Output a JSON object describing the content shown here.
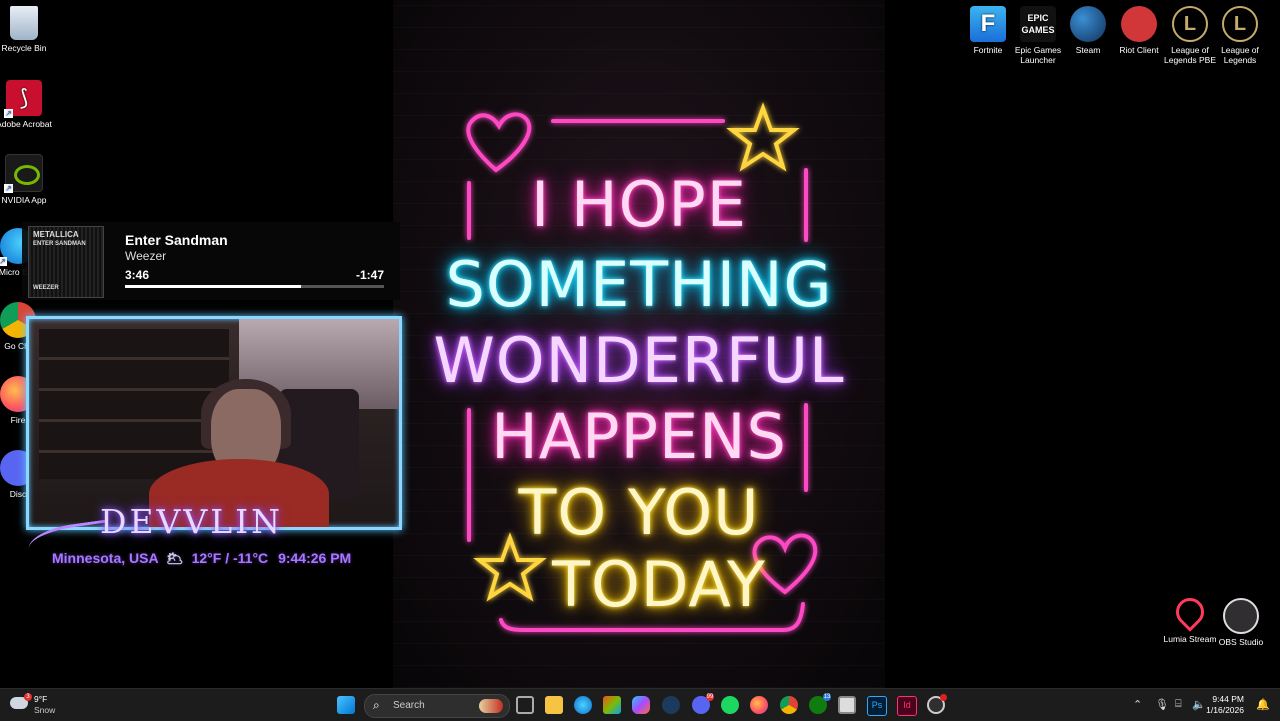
{
  "desktop_icons_left": [
    {
      "label": "Recycle Bin"
    },
    {
      "label": "Adobe Acrobat"
    },
    {
      "label": "NVIDIA App"
    },
    {
      "label": "Micro Edg"
    },
    {
      "label": "Go Chr"
    },
    {
      "label": "Fire"
    },
    {
      "label": "Disc"
    }
  ],
  "desktop_icons_right": [
    {
      "label": "Fortnite",
      "glyph": "F"
    },
    {
      "label": "Epic Games Launcher",
      "glyph": "EPIC GAMES"
    },
    {
      "label": "Steam",
      "glyph": ""
    },
    {
      "label": "Riot Client",
      "glyph": ""
    },
    {
      "label": "League of Legends PBE",
      "glyph": "L"
    },
    {
      "label": "League of Legends",
      "glyph": "L"
    }
  ],
  "desktop_icons_bottom_right": [
    {
      "label": "Lumia Stream"
    },
    {
      "label": "OBS Studio"
    }
  ],
  "wallpaper_lines": [
    "I HOPE",
    "SOMETHING",
    "WONDERFUL",
    "HAPPENS",
    "TO YOU",
    "TODAY"
  ],
  "now_playing": {
    "album_text": "METALLICA",
    "album_sub": "ENTER SANDMAN",
    "album_footer": "WEEZER",
    "title": "Enter Sandman",
    "artist": "Weezer",
    "elapsed": "3:46",
    "remaining": "-1:47",
    "progress_percent": 68
  },
  "overlay": {
    "brand": "DEVVLIN",
    "location": "Minnesota, USA",
    "weather_icon": "🌥",
    "temperature": "12°F / -11°C",
    "time": "9:44:26 PM"
  },
  "taskbar": {
    "weather_temp": "9°F",
    "weather_desc": "Snow",
    "weather_badge": "3",
    "search_placeholder": "Search",
    "clock_time": "9:44 PM",
    "clock_date": "1/16/2026",
    "discord_badge": "99",
    "xbox_badge": "13",
    "apps": [
      "task-view-icon",
      "file-explorer-icon",
      "edge-icon",
      "store-icon",
      "copilot-icon",
      "steam-icon",
      "discord-icon",
      "spotify-icon",
      "firefox-icon",
      "chrome-icon",
      "xbox-icon",
      "snipping-icon",
      "photoshop-icon",
      "indesign-icon",
      "obs-icon"
    ]
  },
  "colors": {
    "neon_pink": "#ff2db8",
    "neon_cyan": "#10d0ff",
    "neon_violet": "#b84cff",
    "neon_yellow": "#ffd000",
    "overlay_purple": "#a877ff",
    "cam_border": "#8ad8ff"
  }
}
